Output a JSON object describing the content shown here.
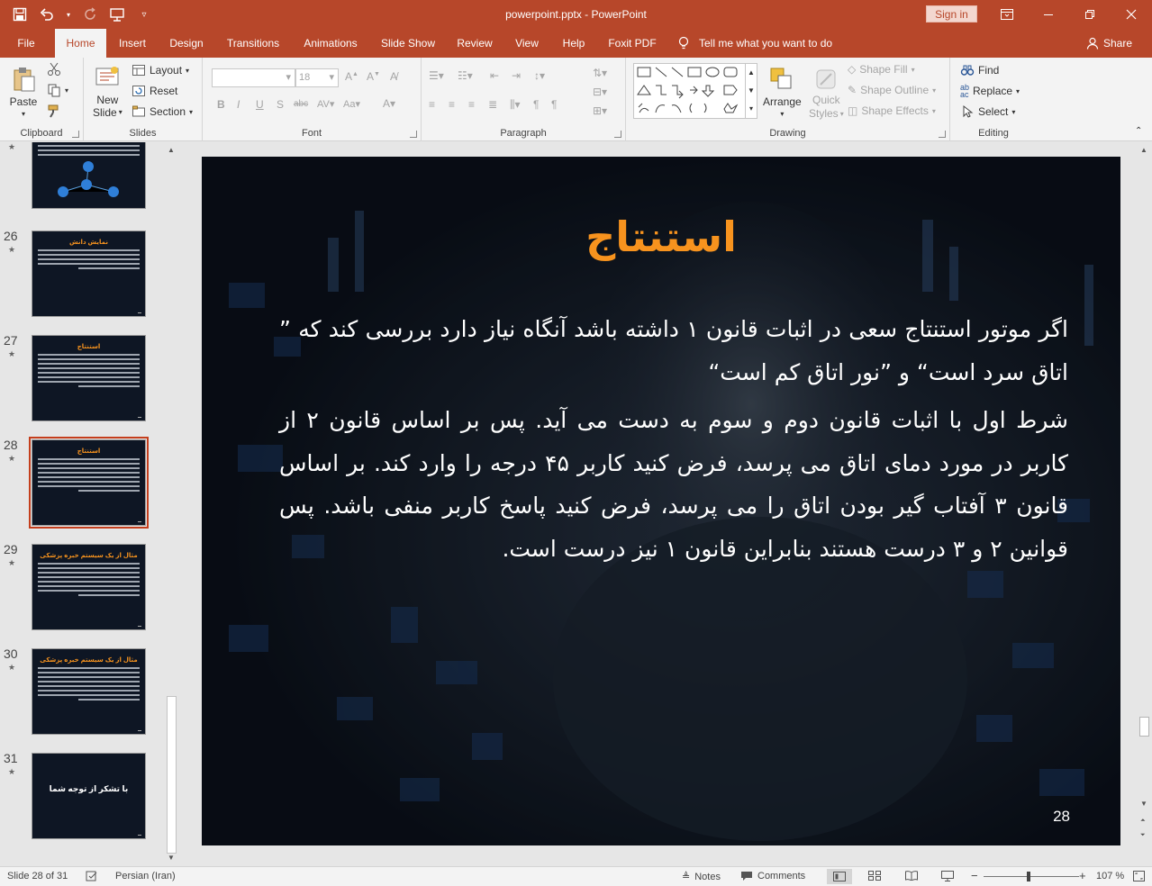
{
  "window": {
    "title": "powerpoint.pptx  -  PowerPoint",
    "signin_label": "Sign in"
  },
  "tabs": [
    {
      "label": "File"
    },
    {
      "label": "Home"
    },
    {
      "label": "Insert"
    },
    {
      "label": "Design"
    },
    {
      "label": "Transitions"
    },
    {
      "label": "Animations"
    },
    {
      "label": "Slide Show"
    },
    {
      "label": "Review"
    },
    {
      "label": "View"
    },
    {
      "label": "Help"
    },
    {
      "label": "Foxit PDF"
    }
  ],
  "tell_me": "Tell me what you want to do",
  "share_label": "Share",
  "ribbon": {
    "clipboard": {
      "paste": "Paste",
      "label": "Clipboard"
    },
    "slides": {
      "new_slide_1": "New",
      "new_slide_2": "Slide",
      "layout": "Layout",
      "reset": "Reset",
      "section": "Section",
      "label": "Slides"
    },
    "font": {
      "size": "18",
      "label": "Font"
    },
    "paragraph": {
      "label": "Paragraph"
    },
    "drawing": {
      "arrange": "Arrange",
      "quick_styles_1": "Quick",
      "quick_styles_2": "Styles",
      "shape_fill": "Shape Fill",
      "shape_outline": "Shape Outline",
      "shape_effects": "Shape Effects",
      "label": "Drawing"
    },
    "editing": {
      "find": "Find",
      "replace": "Replace",
      "select": "Select",
      "label": "Editing"
    }
  },
  "thumbnails": [
    {
      "num": "26",
      "title": "نمایش دانش",
      "kind": "text"
    },
    {
      "num": "27",
      "title": "استنتاج",
      "kind": "text"
    },
    {
      "num": "28",
      "title": "استنتاج",
      "kind": "text",
      "selected": true
    },
    {
      "num": "29",
      "title": "مثال از یک سیستم خبره پزشکی",
      "kind": "text"
    },
    {
      "num": "30",
      "title": "مثال از یک سیستم خبره پزشکی",
      "kind": "text"
    },
    {
      "num": "31",
      "title": "با تشکر از توجه شما",
      "kind": "center"
    }
  ],
  "slide": {
    "title": "استنتاج",
    "para1": "اگر موتور استنتاج سعی در اثبات قانون ۱ داشته باشد آنگاه نیاز دارد بررسی کند که ” اتاق سرد است“ و ”نور اتاق کم است“",
    "para2": "شرط اول با اثبات قانون دوم و سوم به دست می آید. پس بر اساس قانون ۲ از کاربر در مورد دمای اتاق می پرسد، فرض کنید کاربر ۴۵ درجه را وارد کند. بر اساس قانون ۳ آفتاب گیر بودن اتاق را می پرسد، فرض کنید پاسخ کاربر منفی باشد. پس قوانین ۲ و ۳ درست هستند بنابراین قانون ۱ نیز درست است.",
    "page_number": "28"
  },
  "status": {
    "slide_info": "Slide 28 of 31",
    "language": "Persian (Iran)",
    "notes": "Notes",
    "comments": "Comments",
    "zoom": "107 %"
  },
  "colors": {
    "accent": "#b7472a",
    "title_orange": "#f7931e"
  }
}
